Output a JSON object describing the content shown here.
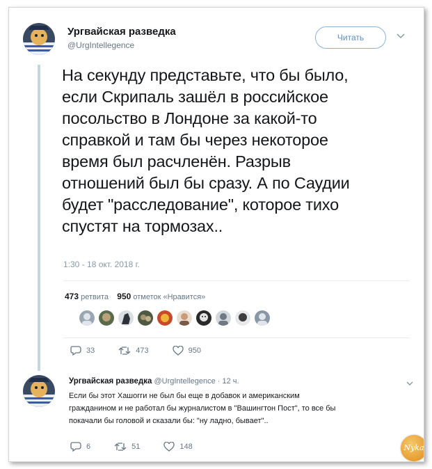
{
  "tweet": {
    "display_name": "Ургвайская разведка",
    "handle": "@UrgIntellegence",
    "follow_label": "Читать",
    "text_lines": [
      "На секунду представьте, что бы было,",
      "если Скрипаль зашёл в российское",
      "посольство в Лондоне за какой-то",
      "справкой и там бы через некоторое",
      "время был расчленён. Разрыв",
      "отношений был бы сразу. А по Саудии",
      "будет \"расследование\", которое тихо",
      "спустят на тормозах.."
    ],
    "timestamp": "1:30 - 18 окт. 2018 г.",
    "retweets_count": "473",
    "retweets_label": "ретвита",
    "likes_count": "950",
    "likes_label": "отметок «Нравится»",
    "actions": {
      "replies": "33",
      "retweets": "473",
      "likes": "950"
    }
  },
  "reply": {
    "display_name": "Ургвайская разведка",
    "handle": "@UrgIntellegence",
    "time": "· 12 ч.",
    "text_lines": [
      "Если бы этот Хашогги не был бы еще в добавок и американским",
      "гражданином и не работал бы журналистом в \"Вашингтон Пост\", то все бы",
      "покачали бы головой и сказали бы: \"ну ладно, бывает\".."
    ],
    "actions": {
      "replies": "6",
      "retweets": "51",
      "likes": "148"
    }
  },
  "watermark": "Nyka",
  "colors": {
    "accent": "#5d8fbf",
    "thread_line": "#c6d6e1",
    "muted": "#657786"
  }
}
